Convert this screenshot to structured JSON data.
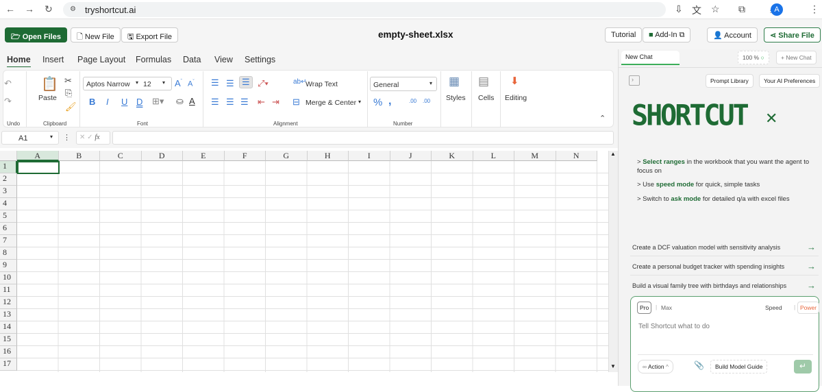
{
  "browser": {
    "url": "tryshortcut.ai",
    "profile": "A"
  },
  "app": {
    "file_title": "empty-sheet.xlsx",
    "open_files": "Open Files",
    "new_file": "New File",
    "export_file": "Export File",
    "tutorial": "Tutorial",
    "add_in": "Add-In",
    "account": "Account",
    "share_file": "Share File"
  },
  "ribbon_tabs": [
    "Home",
    "Insert",
    "Page Layout",
    "Formulas",
    "Data",
    "View",
    "Settings"
  ],
  "ribbon": {
    "paste": "Paste",
    "font_name": "Aptos Narrow",
    "font_size": "12",
    "wrap_text": "Wrap Text",
    "merge_center": "Merge & Center",
    "number_format": "General",
    "styles": "Styles",
    "cells": "Cells",
    "editing": "Editing",
    "groups": {
      "undo": "Undo",
      "clipboard": "Clipboard",
      "font": "Font",
      "alignment": "Alignment",
      "number": "Number"
    }
  },
  "formula_bar": {
    "name_box": "A1",
    "fx": "fx",
    "value": ""
  },
  "grid": {
    "columns": [
      "A",
      "B",
      "C",
      "D",
      "E",
      "F",
      "G",
      "H",
      "I",
      "J",
      "K",
      "L",
      "M",
      "N"
    ],
    "rows": [
      "1",
      "2",
      "3",
      "4",
      "5",
      "6",
      "7",
      "8",
      "9",
      "10",
      "11",
      "12",
      "13",
      "14",
      "15",
      "16",
      "17"
    ],
    "selected": "A1"
  },
  "panel": {
    "tab": "New Chat",
    "zoom": "100 %",
    "new_chat": "+ New Chat",
    "prompt_library": "Prompt Library",
    "ai_prefs": "Your AI Preferences",
    "logo": "SHORTCUT",
    "tips": [
      {
        "pre": "> ",
        "bold": "Select ranges",
        "post": " in the workbook that you want the agent to focus on"
      },
      {
        "pre": "> Use ",
        "bold": "speed mode",
        "post": " for quick, simple tasks"
      },
      {
        "pre": "> Switch to ",
        "bold": "ask mode",
        "post": " for detailed q/a with excel files"
      }
    ],
    "suggestions": [
      "Create a DCF valuation model with sensitivity analysis",
      "Create a personal budget tracker with spending insights",
      "Build a visual family tree with birthdays and relationships"
    ],
    "composer": {
      "pro": "Pro",
      "max": "Max",
      "speed": "Speed",
      "power": "Power",
      "placeholder": "Tell Shortcut what to do",
      "action": "Action",
      "guide": "Build Model Guide"
    }
  },
  "colors": {
    "brand": "#1e6b34",
    "accent_blue": "#3a7bd5",
    "power": "#e8663c"
  }
}
